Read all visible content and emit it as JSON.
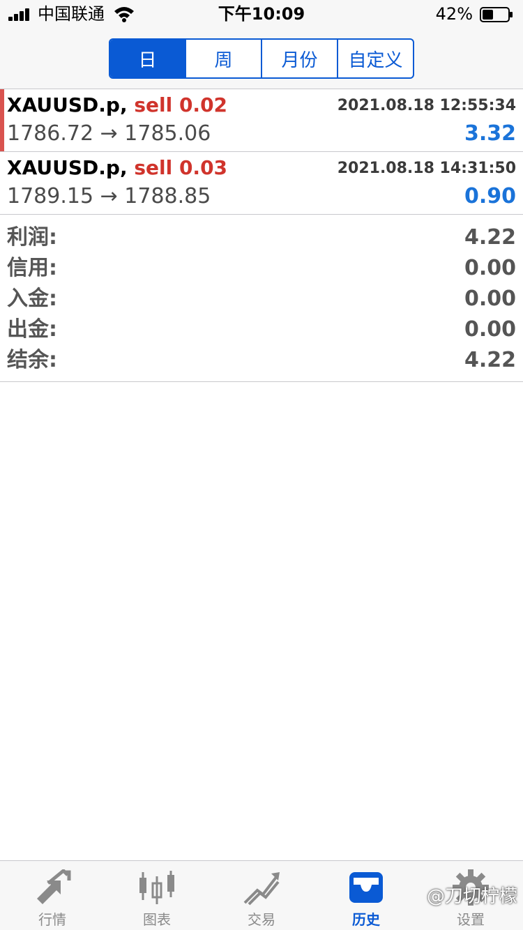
{
  "status_bar": {
    "carrier": "中国联通",
    "time": "下午10:09",
    "battery_percent": "42%",
    "battery_level": 0.42
  },
  "period_tabs": [
    {
      "label": "日",
      "active": true
    },
    {
      "label": "周",
      "active": false
    },
    {
      "label": "月份",
      "active": false
    },
    {
      "label": "自定义",
      "active": false
    }
  ],
  "trades": [
    {
      "symbol": "XAUUSD.p,",
      "side": "sell 0.02",
      "datetime": "2021.08.18 12:55:34",
      "prices": "1786.72 → 1785.06",
      "profit": "3.32"
    },
    {
      "symbol": "XAUUSD.p,",
      "side": "sell 0.03",
      "datetime": "2021.08.18 14:31:50",
      "prices": "1789.15 → 1788.85",
      "profit": "0.90"
    }
  ],
  "summary": [
    {
      "label": "利润:",
      "value": "4.22"
    },
    {
      "label": "信用:",
      "value": "0.00"
    },
    {
      "label": "入金:",
      "value": "0.00"
    },
    {
      "label": "出金:",
      "value": "0.00"
    },
    {
      "label": "结余:",
      "value": "4.22"
    }
  ],
  "tabbar": [
    {
      "label": "行情",
      "icon": "quotes-arrows-icon",
      "active": false
    },
    {
      "label": "图表",
      "icon": "candlestick-chart-icon",
      "active": false
    },
    {
      "label": "交易",
      "icon": "trade-chart-icon",
      "active": false
    },
    {
      "label": "历史",
      "icon": "history-inbox-icon",
      "active": true
    },
    {
      "label": "设置",
      "icon": "gear-icon",
      "active": false
    }
  ],
  "watermark": "@刀切柠檬",
  "colors": {
    "accent_blue": "#0a5ad4",
    "sell_red": "#d0342c",
    "profit_blue": "#1a73d9"
  }
}
